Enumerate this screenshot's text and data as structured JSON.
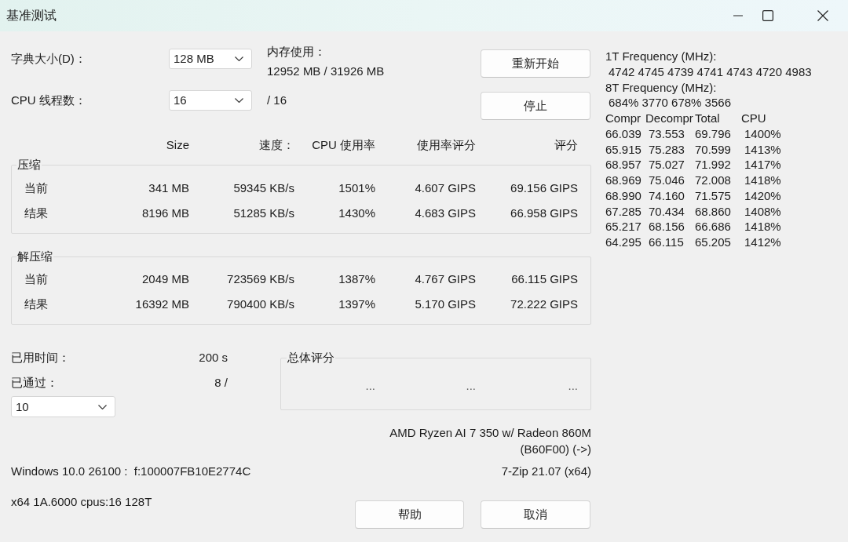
{
  "window": {
    "title": "基准测试"
  },
  "settings": {
    "dictionary": {
      "label": "字典大小(D)：",
      "value": "128 MB"
    },
    "memory": {
      "label": "内存使用：",
      "value": "12952 MB / 31926 MB"
    },
    "threads": {
      "label": "CPU 线程数：",
      "value": "16",
      "total": "/ 16"
    }
  },
  "actions": [
    {
      "label": "重新开始"
    },
    {
      "label": "停止"
    }
  ],
  "results": {
    "columns": [
      "Size",
      "速度：",
      "CPU 使用率",
      "使用率评分",
      "评分"
    ],
    "groups": [
      {
        "title": "压缩",
        "rows": [
          {
            "label": "当前",
            "cells": [
              "341 MB",
              "59345 KB/s",
              "1501%",
              "4.607 GIPS",
              "69.156 GIPS"
            ]
          },
          {
            "label": "结果",
            "cells": [
              "8196 MB",
              "51285 KB/s",
              "1430%",
              "4.683 GIPS",
              "66.958 GIPS"
            ]
          }
        ]
      },
      {
        "title": "解压缩",
        "rows": [
          {
            "label": "当前",
            "cells": [
              "2049 MB",
              "723569 KB/s",
              "1387%",
              "4.767 GIPS",
              "66.115 GIPS"
            ]
          },
          {
            "label": "结果",
            "cells": [
              "16392 MB",
              "790400 KB/s",
              "1397%",
              "5.170 GIPS",
              "72.222 GIPS"
            ]
          }
        ]
      }
    ]
  },
  "progress": {
    "elapsed_label": "已用时间：",
    "elapsed": "200 s",
    "passes_label": "已通过：",
    "passes": "8 /",
    "passes_select": "10"
  },
  "total": {
    "title": "总体评分",
    "values": [
      "...",
      "...",
      "..."
    ]
  },
  "cpu": {
    "name": "AMD Ryzen AI 7 350 w/ Radeon 860M",
    "id": "(B60F00) (->)"
  },
  "system": {
    "os": "Windows 10.0 26100 :  f:100007FB10E2774C",
    "version": "7-Zip 21.07 (x64)",
    "arch": "x64 1A.6000 cpus:16 128T"
  },
  "footer_buttons": [
    {
      "label": "帮助"
    },
    {
      "label": "取消"
    }
  ],
  "log": {
    "lines": [
      {
        "kind": "heading",
        "text": "1T Frequency (MHz):"
      },
      {
        "kind": "values",
        "text": "4742 4745 4739 4741 4743 4720 4983"
      },
      {
        "kind": "heading",
        "text": "8T Frequency (MHz):"
      },
      {
        "kind": "values",
        "text": "684% 3770 678% 3566"
      }
    ],
    "columns": [
      "Compr",
      "Decompr",
      "Total",
      "CPU"
    ],
    "rows": [
      [
        "66.039",
        "73.553",
        "69.796",
        "1400%"
      ],
      [
        "65.915",
        "75.283",
        "70.599",
        "1413%"
      ],
      [
        "68.957",
        "75.027",
        "71.992",
        "1417%"
      ],
      [
        "68.969",
        "75.046",
        "72.008",
        "1418%"
      ],
      [
        "68.990",
        "74.160",
        "71.575",
        "1420%"
      ],
      [
        "67.285",
        "70.434",
        "68.860",
        "1408%"
      ],
      [
        "65.217",
        "68.156",
        "66.686",
        "1418%"
      ],
      [
        "64.295",
        "66.115",
        "65.205",
        "1412%"
      ]
    ]
  }
}
